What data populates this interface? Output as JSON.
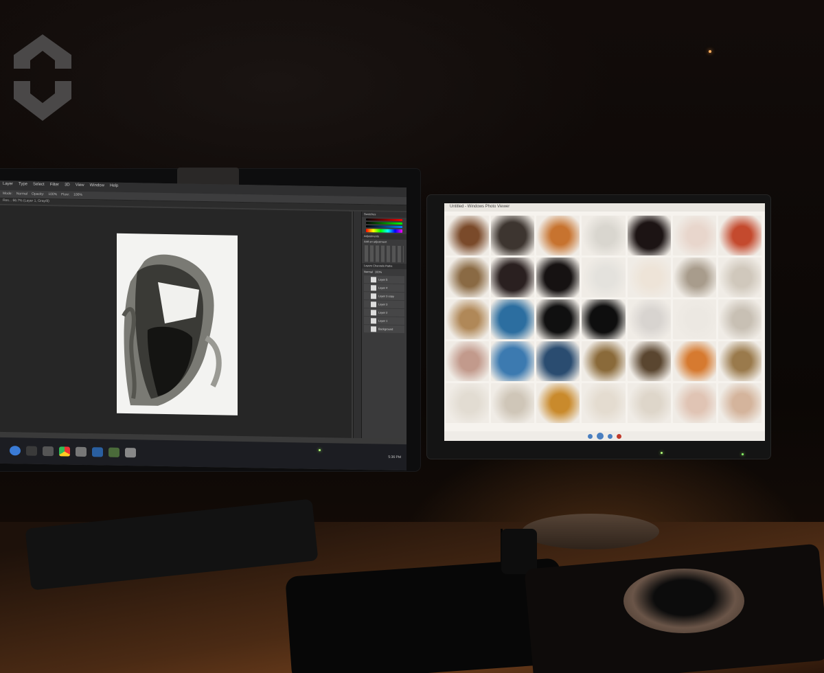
{
  "photo": {
    "description_tags": [
      "dual-monitor-setup",
      "photoshop-window",
      "image-gallery-window",
      "desk"
    ]
  },
  "left_monitor": {
    "menu_items": [
      "Layer",
      "Type",
      "Select",
      "Filter",
      "3D",
      "View",
      "Window",
      "Help"
    ],
    "options_bar": [
      "Mode:",
      "Normal",
      "Opacity:",
      "100%",
      "Flow:",
      "100%"
    ],
    "doc_tab": "Res... 66.7% (Layer 1, Gray/8)",
    "panels": {
      "color_tab": "Swatches",
      "adjust_tab": "Adjustments",
      "adjust_sub": "Add an adjustment",
      "layers_tabs": [
        "Layers",
        "Channels",
        "Paths"
      ],
      "blend_mode": "Normal",
      "opacity": "100%",
      "layers": [
        "Layer 5",
        "Layer 4",
        "Layer 3 copy",
        "Layer 3",
        "Layer 2",
        "Layer 1",
        "Background"
      ]
    },
    "taskbar_clock": "5:36 PM"
  },
  "right_monitor": {
    "window_title": "Untitled - Windows Photo Viewer",
    "tile_colors": [
      "#7a4a2a",
      "#3d3530",
      "#c7732f",
      "#d9d6cf",
      "#1c1414",
      "#e8d6cc",
      "#c44a2e",
      "#8a6a44",
      "#2a2020",
      "#161212",
      "#e4e2dd",
      "#eee4d8",
      "#a89c8c",
      "#d0c8bc",
      "#b08858",
      "#2c6ea0",
      "#101010",
      "#0e0e0e",
      "#d8d4d0",
      "#ece8e2",
      "#c8c0b4",
      "#c29a8c",
      "#3c7ab0",
      "#2a4c70",
      "#8a6a3a",
      "#5a4630",
      "#d67a30",
      "#9a7a4c",
      "#e2dcd2",
      "#cfc6b8",
      "#c98a2c",
      "#e4dcd0",
      "#ded6ca",
      "#e0c4b4",
      "#d4b49c"
    ]
  },
  "colors": {
    "screen_dark": "#262626",
    "gallery_bg": "#f6f3ee",
    "desk_wood": "#6a3c1b"
  }
}
